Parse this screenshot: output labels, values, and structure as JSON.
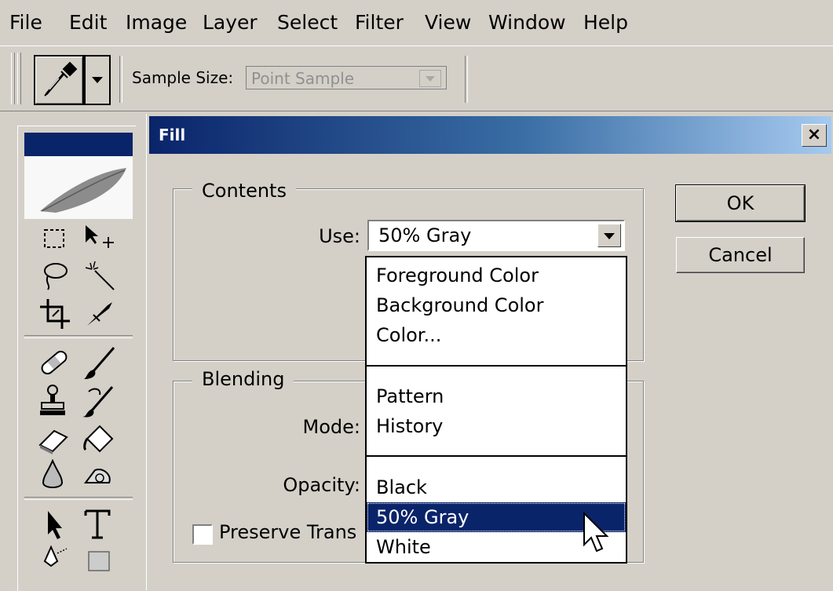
{
  "menu": {
    "items": [
      "File",
      "Edit",
      "Image",
      "Layer",
      "Select",
      "Filter",
      "View",
      "Window",
      "Help"
    ]
  },
  "options_bar": {
    "tool_icon": "eyedropper-icon",
    "sample_size_label": "Sample Size:",
    "sample_size_value": "Point Sample"
  },
  "toolbox": {
    "tools": [
      "marquee-icon",
      "move-icon",
      "lasso-icon",
      "magic-wand-icon",
      "crop-icon",
      "slice-icon",
      "healing-brush-icon",
      "brush-icon",
      "clone-stamp-icon",
      "history-brush-icon",
      "eraser-icon",
      "paint-bucket-icon",
      "blur-icon",
      "dodge-icon",
      "path-selection-icon",
      "type-icon",
      "pen-icon",
      "rectangle-icon"
    ]
  },
  "fill_dialog": {
    "title": "Fill",
    "close_label": "×",
    "contents_legend": "Contents",
    "use_label": "Use:",
    "use_value": "50% Gray",
    "blending_legend": "Blending",
    "mode_label": "Mode:",
    "opacity_label": "Opacity:",
    "preserve_label": "Preserve Trans",
    "ok_label": "OK",
    "cancel_label": "Cancel",
    "dropdown_groups": [
      [
        "Foreground Color",
        "Background Color",
        "Color..."
      ],
      [
        "Pattern",
        "History"
      ],
      [
        "Black",
        "50% Gray",
        "White"
      ]
    ],
    "selected_option": "50% Gray"
  },
  "colors": {
    "face": "#d4d0c8",
    "title_start": "#0a246a",
    "title_end": "#a6caf0",
    "selection": "#0a246a"
  }
}
